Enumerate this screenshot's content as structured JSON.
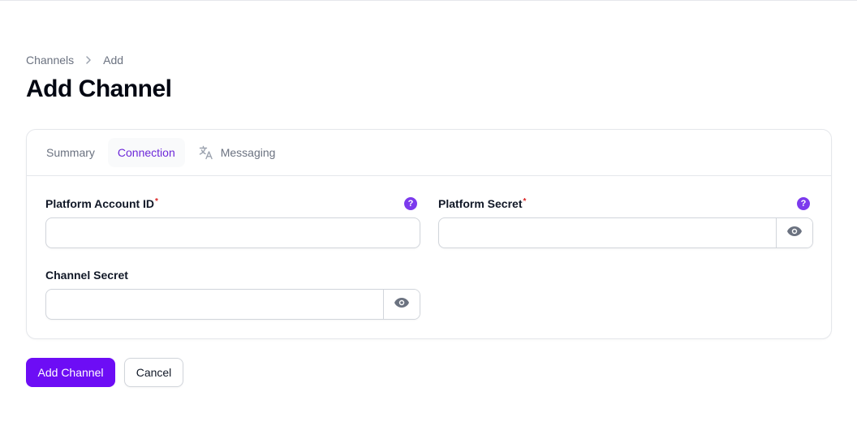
{
  "breadcrumb": {
    "items": [
      "Channels",
      "Add"
    ]
  },
  "page": {
    "title": "Add Channel"
  },
  "tabs": [
    {
      "label": "Summary"
    },
    {
      "label": "Connection"
    },
    {
      "label": "Messaging"
    }
  ],
  "active_tab": "Connection",
  "fields": {
    "platform_account_id": {
      "label": "Platform Account ID",
      "required_mark": "*",
      "value": "",
      "help_icon": "question-icon",
      "help_glyph": "?"
    },
    "platform_secret": {
      "label": "Platform Secret",
      "required_mark": "*",
      "value": "",
      "help_icon": "question-icon",
      "help_glyph": "?",
      "reveal_icon": "eye-icon"
    },
    "channel_secret": {
      "label": "Channel Secret",
      "value": "",
      "reveal_icon": "eye-icon"
    }
  },
  "actions": {
    "submit_label": "Add Channel",
    "cancel_label": "Cancel"
  },
  "colors": {
    "accent": "#6d0df5",
    "active_tab_text": "#6d28d9",
    "help_icon": "#7c3aed",
    "required": "#dc2626"
  },
  "icons": {
    "breadcrumb_separator": "chevron-right-icon",
    "messaging_tab": "translate-icon"
  }
}
